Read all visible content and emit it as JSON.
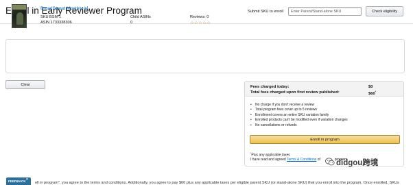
{
  "header": {
    "title": "Enroll in Early Reviewer Program",
    "sku_label": "Submit SKU to enroll",
    "sku_placeholder": "Enter Parent/Stand-alone SKU",
    "check_button": "Check eligibility"
  },
  "product": {
    "name": "BroadSword Monthly #1",
    "sku": "SKU BSM-1",
    "asin": "ASIN 1733338306",
    "child_asins_label": "Child ASINs",
    "child_asins_value": "0",
    "reviews_label": "Reviews: 0",
    "stars_display": "☆☆☆☆☆",
    "rating": 0,
    "rating_max": 5
  },
  "clear_button": "Clear",
  "fees": {
    "today_label": "Fees charged today:",
    "today_value": "$0",
    "total_label": "Total fees charged upon first review published:",
    "total_value": "$60",
    "total_marker": "*",
    "bullets": [
      "No charge if you don't receive a review",
      "Total program fees cover up to 5 reviews",
      "Enrollment covers an entire SKU variation family",
      "Enrolled products can't be modified even if variation changes",
      "No cancellations or refunds"
    ],
    "enroll_button": "Enroll in program",
    "plus_marker": "*",
    "plus_note": "Plus any applicable taxes",
    "agree_prefix": "I have read and agreed ",
    "terms_link": "Terms & Conditions",
    "agree_suffix": " of ",
    "agree_end": " program"
  },
  "watermark": {
    "text": "didgou跨境",
    "icon": "wechat-icon"
  },
  "feedback": {
    "label": "FEEDBACK",
    "close": "×"
  },
  "footer": {
    "text": "ell in program\", you agree to the terms and conditions. Additionally, you agree to pay $60 plus any applicable taxes per eligible parent SKU (or stand-alone SKU) that you enroll into the program. Once enrolled, SKUs"
  },
  "colors": {
    "link": "#0066c0",
    "primary_button": "#f0c14b",
    "star": "#b0892a",
    "feedback_tab": "#2b6f9a"
  }
}
